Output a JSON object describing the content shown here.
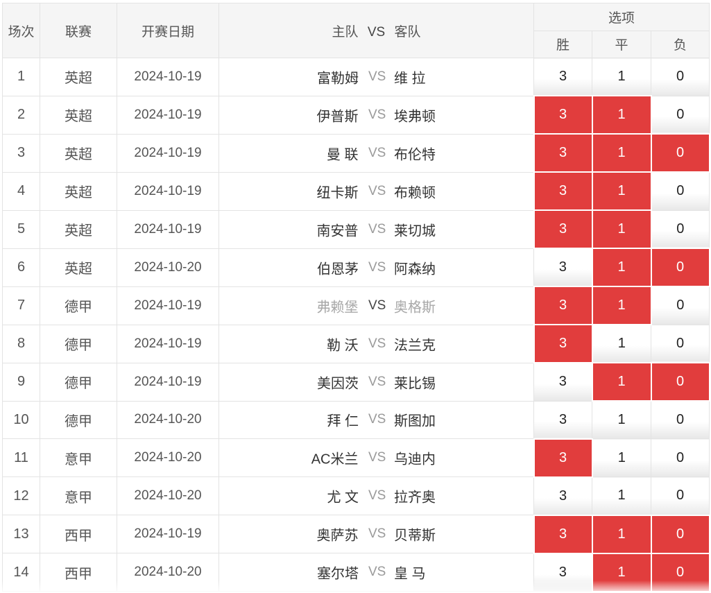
{
  "header": {
    "index": "场次",
    "league": "联赛",
    "date": "开赛日期",
    "home": "主队",
    "vs": "VS",
    "away": "客队",
    "options": "选项",
    "win": "胜",
    "draw": "平",
    "loss": "负"
  },
  "colors": {
    "selected": "#e13d3d",
    "muted_text": "#a8a8a8"
  },
  "rows": [
    {
      "idx": "1",
      "league": "英超",
      "date": "2024-10-19",
      "home": "富勒姆",
      "vs": "VS",
      "away": "维 拉",
      "w": "3",
      "d": "1",
      "l": "0",
      "sel": [
        false,
        false,
        false
      ]
    },
    {
      "idx": "2",
      "league": "英超",
      "date": "2024-10-19",
      "home": "伊普斯",
      "vs": "VS",
      "away": "埃弗顿",
      "w": "3",
      "d": "1",
      "l": "0",
      "sel": [
        true,
        true,
        false
      ]
    },
    {
      "idx": "3",
      "league": "英超",
      "date": "2024-10-19",
      "home": "曼 联",
      "vs": "VS",
      "away": "布伦特",
      "w": "3",
      "d": "1",
      "l": "0",
      "sel": [
        true,
        true,
        true
      ]
    },
    {
      "idx": "4",
      "league": "英超",
      "date": "2024-10-19",
      "home": "纽卡斯",
      "vs": "VS",
      "away": "布赖顿",
      "w": "3",
      "d": "1",
      "l": "0",
      "sel": [
        true,
        true,
        false
      ]
    },
    {
      "idx": "5",
      "league": "英超",
      "date": "2024-10-19",
      "home": "南安普",
      "vs": "VS",
      "away": "莱切城",
      "w": "3",
      "d": "1",
      "l": "0",
      "sel": [
        true,
        true,
        false
      ]
    },
    {
      "idx": "6",
      "league": "英超",
      "date": "2024-10-20",
      "home": "伯恩茅",
      "vs": "VS",
      "away": "阿森纳",
      "w": "3",
      "d": "1",
      "l": "0",
      "sel": [
        false,
        true,
        true
      ]
    },
    {
      "idx": "7",
      "league": "德甲",
      "date": "2024-10-19",
      "home": "弗赖堡",
      "vs": "VS",
      "away": "奥格斯",
      "w": "3",
      "d": "1",
      "l": "0",
      "sel": [
        true,
        true,
        false
      ],
      "muted": true
    },
    {
      "idx": "8",
      "league": "德甲",
      "date": "2024-10-19",
      "home": "勒 沃",
      "vs": "VS",
      "away": "法兰克",
      "w": "3",
      "d": "1",
      "l": "0",
      "sel": [
        true,
        false,
        false
      ]
    },
    {
      "idx": "9",
      "league": "德甲",
      "date": "2024-10-19",
      "home": "美因茨",
      "vs": "VS",
      "away": "莱比锡",
      "w": "3",
      "d": "1",
      "l": "0",
      "sel": [
        false,
        true,
        true
      ]
    },
    {
      "idx": "10",
      "league": "德甲",
      "date": "2024-10-20",
      "home": "拜 仁",
      "vs": "VS",
      "away": "斯图加",
      "w": "3",
      "d": "1",
      "l": "0",
      "sel": [
        false,
        false,
        false
      ]
    },
    {
      "idx": "11",
      "league": "意甲",
      "date": "2024-10-20",
      "home": "AC米兰",
      "vs": "VS",
      "away": "乌迪内",
      "w": "3",
      "d": "1",
      "l": "0",
      "sel": [
        true,
        false,
        false
      ]
    },
    {
      "idx": "12",
      "league": "意甲",
      "date": "2024-10-20",
      "home": "尤 文",
      "vs": "VS",
      "away": "拉齐奥",
      "w": "3",
      "d": "1",
      "l": "0",
      "sel": [
        false,
        false,
        false
      ]
    },
    {
      "idx": "13",
      "league": "西甲",
      "date": "2024-10-19",
      "home": "奥萨苏",
      "vs": "VS",
      "away": "贝蒂斯",
      "w": "3",
      "d": "1",
      "l": "0",
      "sel": [
        true,
        true,
        true
      ]
    },
    {
      "idx": "14",
      "league": "西甲",
      "date": "2024-10-20",
      "home": "塞尔塔",
      "vs": "VS",
      "away": "皇 马",
      "w": "3",
      "d": "1",
      "l": "0",
      "sel": [
        false,
        true,
        true
      ]
    }
  ]
}
